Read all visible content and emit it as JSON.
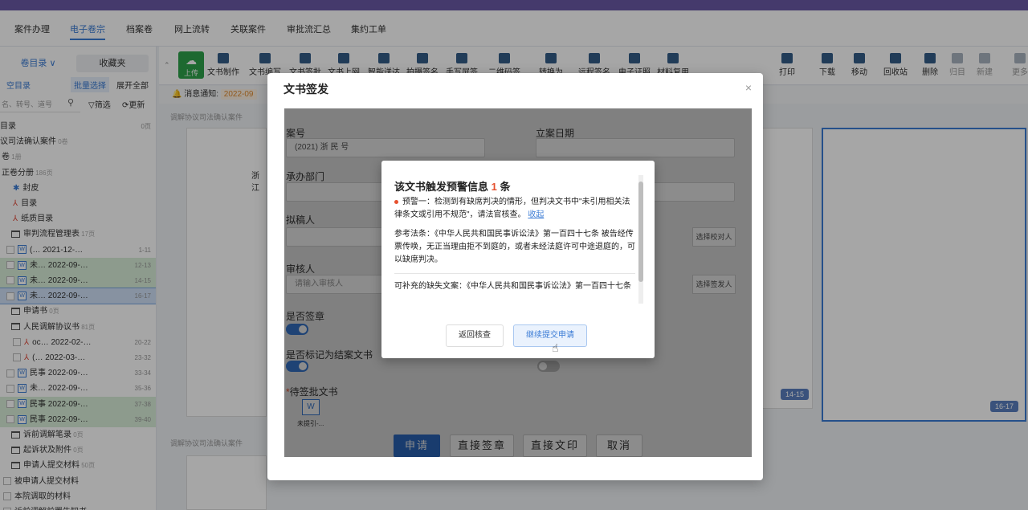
{
  "nav": {
    "items": [
      "案件办理",
      "电子卷宗",
      "档案卷",
      "网上流转",
      "关联案件",
      "审批流汇总",
      "集约工单"
    ]
  },
  "left": {
    "tab_active": "卷目录 ∨",
    "tab_other": "收藏夹",
    "btn_empty": "空目录",
    "btn_batch": "批量选择",
    "btn_expand": "展开全部",
    "search_placeholder": "名、转号、道号",
    "filter": "筛选",
    "update": "更新",
    "tree": [
      {
        "label": "目录",
        "pages": "0页",
        "type": "root"
      },
      {
        "label": "议司法确认案件",
        "note": "0卷",
        "type": "case"
      },
      {
        "label": "卷",
        "note": "1册",
        "type": "vol"
      },
      {
        "label": "正卷分册",
        "note": "186页",
        "type": "vol"
      },
      {
        "label": "封皮",
        "type": "seal"
      },
      {
        "label": "目录",
        "type": "pdf"
      },
      {
        "label": "纸质目录",
        "type": "pdf"
      },
      {
        "label": "审判流程管理表",
        "note": "17页",
        "type": "folder"
      },
      {
        "label": "(…  2021-12-…",
        "pages": "1-11",
        "type": "word"
      },
      {
        "label": "未…  2022-09-…",
        "pages": "12-13",
        "type": "word",
        "hl": "green"
      },
      {
        "label": "未…  2022-09-…",
        "pages": "14-15",
        "type": "word",
        "hl": "green"
      },
      {
        "label": "未…  2022-09-…",
        "pages": "16-17",
        "type": "word",
        "hl": "blue"
      },
      {
        "label": "申请书",
        "note": "0页",
        "type": "folder"
      },
      {
        "label": "人民调解协议书",
        "note": "81页",
        "type": "folder"
      },
      {
        "label": "oc…  2022-02-…",
        "pages": "20-22",
        "type": "pdf"
      },
      {
        "label": "(…  2022-03-…",
        "pages": "23-32",
        "type": "pdf"
      },
      {
        "label": "民事 2022-09-…",
        "pages": "33-34",
        "type": "word"
      },
      {
        "label": "未…  2022-09-…",
        "pages": "35-36",
        "type": "word"
      },
      {
        "label": "民事 2022-09-…",
        "pages": "37-38",
        "type": "word",
        "hl": "green"
      },
      {
        "label": "民事 2022-09-…",
        "pages": "39-40",
        "type": "word",
        "hl": "green"
      },
      {
        "label": "诉前调解笔录",
        "note": "0页",
        "type": "folder"
      },
      {
        "label": "起诉状及附件",
        "note": "0页",
        "type": "folder"
      },
      {
        "label": "申请人提交材料",
        "note": "50页",
        "type": "folder"
      },
      {
        "label": "被申请人提交材料",
        "type": "folder2"
      },
      {
        "label": "本院调取的材料",
        "type": "folder2"
      },
      {
        "label": "诉前调解前置告知书",
        "type": "folder2"
      }
    ]
  },
  "toolbar": {
    "upload": "上传",
    "tools": [
      "文书制作",
      "文书编写",
      "文书签批",
      "文书上网",
      "智能送达",
      "拍摄签名",
      "手写屏签名",
      "二维码签名",
      "转换为Word",
      "远程签名",
      "电子证照",
      "材料复用",
      "打印",
      "下载",
      "移动",
      "回收站",
      "删除",
      "归目",
      "新建",
      "更多"
    ]
  },
  "notice": {
    "label": "消息通知:",
    "badge": "2022-09"
  },
  "main": {
    "group1": "调解协议司法确认案件",
    "group2": "调解协议司法确认案件",
    "card_text": "浙江",
    "badge1": "14-15",
    "badge2": "16-17"
  },
  "dialog": {
    "title": "文书签发",
    "close": "×",
    "case_label": "案号",
    "case_value": "(2021) 浙         民              号",
    "date_label": "立案日期",
    "dept_label": "承办部门",
    "drafter_label": "拟稿人",
    "reviewer_label": "审核人",
    "reviewer_placeholder": "请输入审核人",
    "select_proof": "选择校对人",
    "select_signer": "选择签发人",
    "sign_label": "是否签章",
    "end_label": "是否标记为结案文书",
    "pending_label": "待签批文书",
    "pending_file": "未提引-...",
    "btn_apply": "申请",
    "btn_direct_sign": "直接签章",
    "btn_direct_print": "直接文印",
    "btn_cancel": "取消"
  },
  "warning": {
    "title_prefix": "该文书触发预警信息",
    "count": "1",
    "title_suffix": "条",
    "item": "预警一：检测到有缺席判决的情形，但判决文书中\"未引用相关法律条文或引用不规范\"，请法官核查。",
    "collapse": "收起",
    "ref": "参考法条：《中华人民共和国民事诉讼法》第一百四十七条 被告经传票传唤，无正当理由拒不到庭的，或者未经法庭许可中途退庭的，可以缺席判决。",
    "supp": "可补充的缺失文案：《中华人民共和国民事诉讼法》第一百四十七条",
    "btn_back": "返回核查",
    "btn_continue": "继续提交申请"
  },
  "colors": {
    "accent": "#3a7bd5",
    "primary": "#2f6ec9",
    "warn": "#e6502e",
    "purple": "#6b5aa6"
  }
}
